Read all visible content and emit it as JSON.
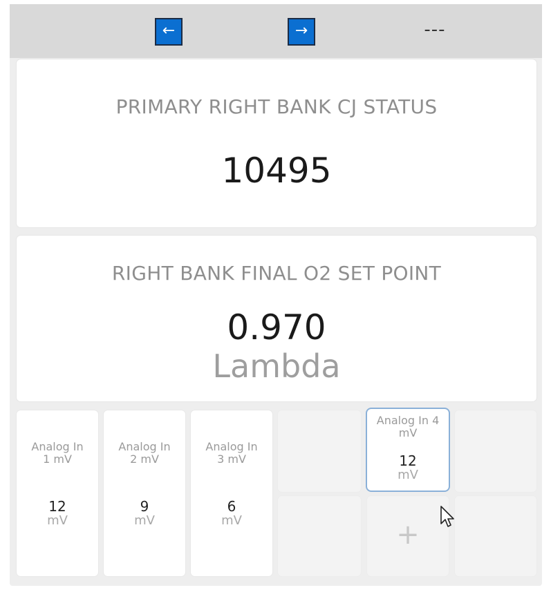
{
  "toolbar": {
    "prev_icon": "←",
    "next_icon": "→",
    "status_text": "---"
  },
  "cards": [
    {
      "title": "PRIMARY RIGHT BANK CJ STATUS",
      "value": "10495",
      "unit": ""
    },
    {
      "title": "RIGHT BANK FINAL O2 SET POINT",
      "value": "0.970",
      "unit": "Lambda"
    }
  ],
  "tiles": [
    {
      "label_line1": "Analog In",
      "label_line2": "1 mV",
      "value": "12",
      "unit": "mV"
    },
    {
      "label_line1": "Analog In",
      "label_line2": "2 mV",
      "value": "9",
      "unit": "mV"
    },
    {
      "label_line1": "Analog In",
      "label_line2": "3 mV",
      "value": "6",
      "unit": "mV"
    },
    {
      "label_line1": "Analog In 4",
      "label_line2": "mV",
      "value": "12",
      "unit": "mV"
    }
  ],
  "add_tile": {
    "icon": "+"
  },
  "icons": {
    "prev": "arrow-left-icon",
    "next": "arrow-right-icon",
    "add": "plus-icon",
    "cursor": "mouse-pointer-icon"
  },
  "colors": {
    "nav_button": "#0b6fd1",
    "selected_border": "#8ab0d8",
    "toolbar": "#d9d9d9"
  }
}
